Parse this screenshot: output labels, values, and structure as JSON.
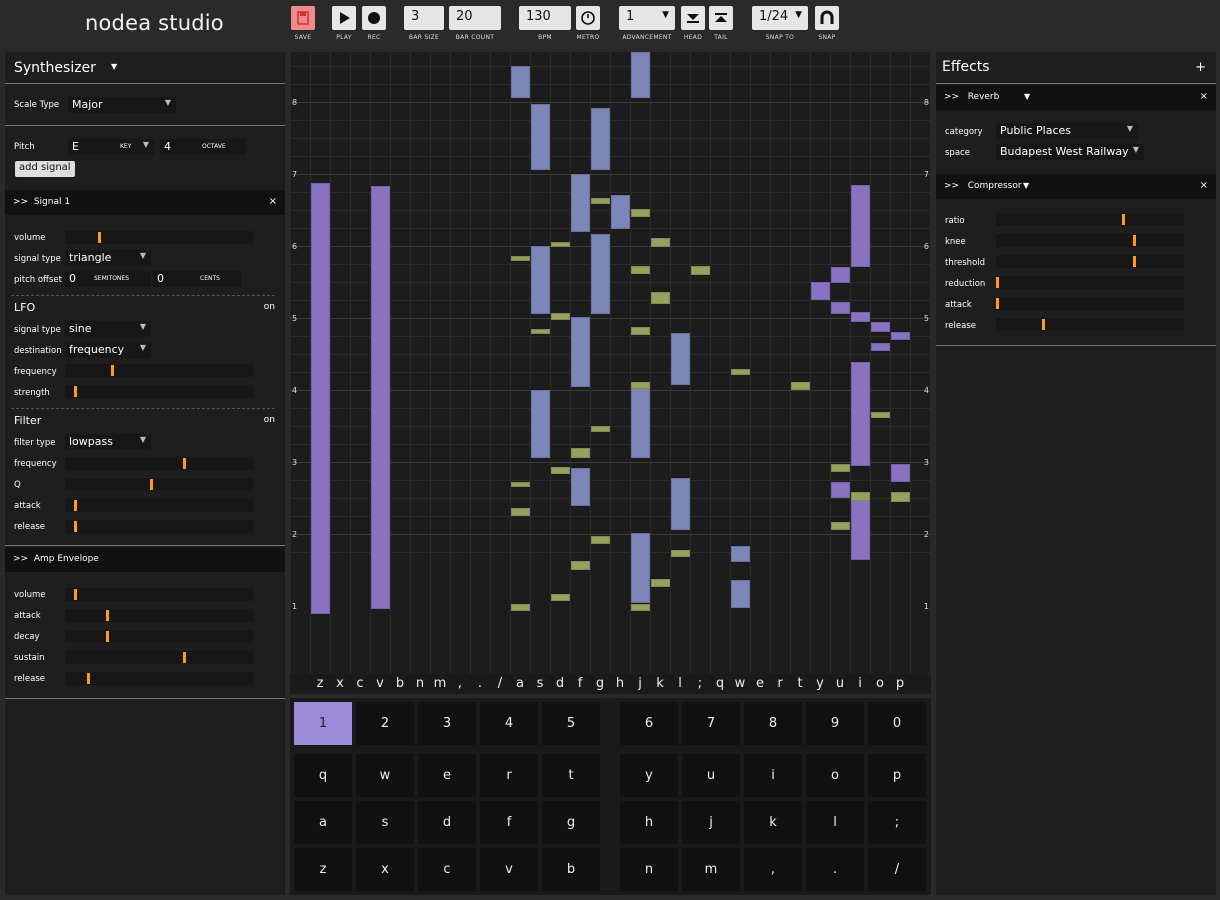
{
  "app": {
    "title": "nodea studio"
  },
  "toolbar": {
    "save_label": "SAVE",
    "play_label": "PLAY",
    "rec_label": "REC",
    "bar_size": "3",
    "bar_size_label": "BAR SIZE",
    "bar_count": "20",
    "bar_count_label": "BAR COUNT",
    "bpm": "130",
    "bpm_label": "BPM",
    "metro_label": "METRO",
    "advancement": "1",
    "advancement_label": "ADVANCEMENT",
    "head_label": "HEAD",
    "tail_label": "TAIL",
    "snap_to": "1/24",
    "snap_to_label": "SNAP TO",
    "snap_label": "SNAP"
  },
  "synth": {
    "title": "Synthesizer",
    "scale_type_label": "Scale Type",
    "scale_type": "Major",
    "pitch_label": "Pitch",
    "pitch_key": "E",
    "key_label": "KEY",
    "octave": "4",
    "octave_label": "OCTAVE",
    "add_signal": "add signal",
    "signal1": {
      "title": "Signal 1",
      "toggle": ">>",
      "close": "×",
      "volume_label": "volume",
      "volume": 0.18,
      "signal_type_label": "signal type",
      "signal_type": "triangle",
      "pitch_offset_label": "pitch offset",
      "semitones": "0",
      "semitones_label": "SEMITONES",
      "cents": "0",
      "cents_label": "CENTS",
      "lfo": {
        "title": "LFO",
        "state": "on",
        "signal_type_label": "signal type",
        "signal_type": "sine",
        "destination_label": "destination",
        "destination": "frequency",
        "frequency_label": "frequency",
        "frequency": 0.25,
        "strength_label": "strength",
        "strength": 0.05
      },
      "filter": {
        "title": "Filter",
        "state": "on",
        "filter_type_label": "filter type",
        "filter_type": "lowpass",
        "frequency_label": "frequency",
        "frequency": 0.64,
        "q_label": "Q",
        "q": 0.46,
        "attack_label": "attack",
        "attack": 0.05,
        "release_label": "release",
        "release": 0.05
      }
    },
    "amp_envelope": {
      "title": "Amp Envelope",
      "toggle": ">>",
      "volume_label": "volume",
      "volume": 0.05,
      "attack_label": "attack",
      "attack": 0.22,
      "decay_label": "decay",
      "decay": 0.22,
      "sustain_label": "sustain",
      "sustain": 0.64,
      "release_label": "release",
      "release": 0.12
    }
  },
  "effects": {
    "title": "Effects",
    "add": "+",
    "reverb": {
      "title": "Reverb",
      "toggle": ">>",
      "close": "×",
      "category_label": "category",
      "category": "Public Places",
      "space_label": "space",
      "space": "Budapest West Railway"
    },
    "compressor": {
      "title": "Compressor",
      "toggle": ">>",
      "close": "×",
      "ratio_label": "ratio",
      "ratio": 0.68,
      "knee_label": "knee",
      "knee": 0.74,
      "threshold_label": "threshold",
      "threshold": 0.74,
      "reduction_label": "reduction",
      "reduction": 0.0,
      "attack_label": "attack",
      "attack": 0.0,
      "release_label": "release",
      "release": 0.25
    }
  },
  "grid": {
    "y_labels": [
      "8",
      "7",
      "6",
      "5",
      "4",
      "3",
      "2",
      "1"
    ],
    "key_labels": [
      "z",
      "x",
      "c",
      "v",
      "b",
      "n",
      "m",
      ",",
      ".",
      "/",
      "a",
      "s",
      "d",
      "f",
      "g",
      "h",
      "j",
      "k",
      "l",
      ";",
      "q",
      "w",
      "e",
      "r",
      "t",
      "y",
      "u",
      "i",
      "o",
      "p"
    ]
  },
  "keyboard": {
    "rows": [
      [
        "1",
        "2",
        "3",
        "4",
        "5",
        "6",
        "7",
        "8",
        "9",
        "0"
      ],
      [
        "q",
        "w",
        "e",
        "r",
        "t",
        "y",
        "u",
        "i",
        "o",
        "p"
      ],
      [
        "a",
        "s",
        "d",
        "f",
        "g",
        "h",
        "j",
        "k",
        "l",
        ";"
      ],
      [
        "z",
        "x",
        "c",
        "v",
        "b",
        "n",
        "m",
        ",",
        ".",
        "/"
      ]
    ],
    "active": "1"
  },
  "colors": {
    "accent": "#ff9a1e",
    "note_blue": "#7c86b8",
    "note_purple": "#8a72c2",
    "note_green": "#98a060",
    "active_key": "#9a8ad8"
  }
}
